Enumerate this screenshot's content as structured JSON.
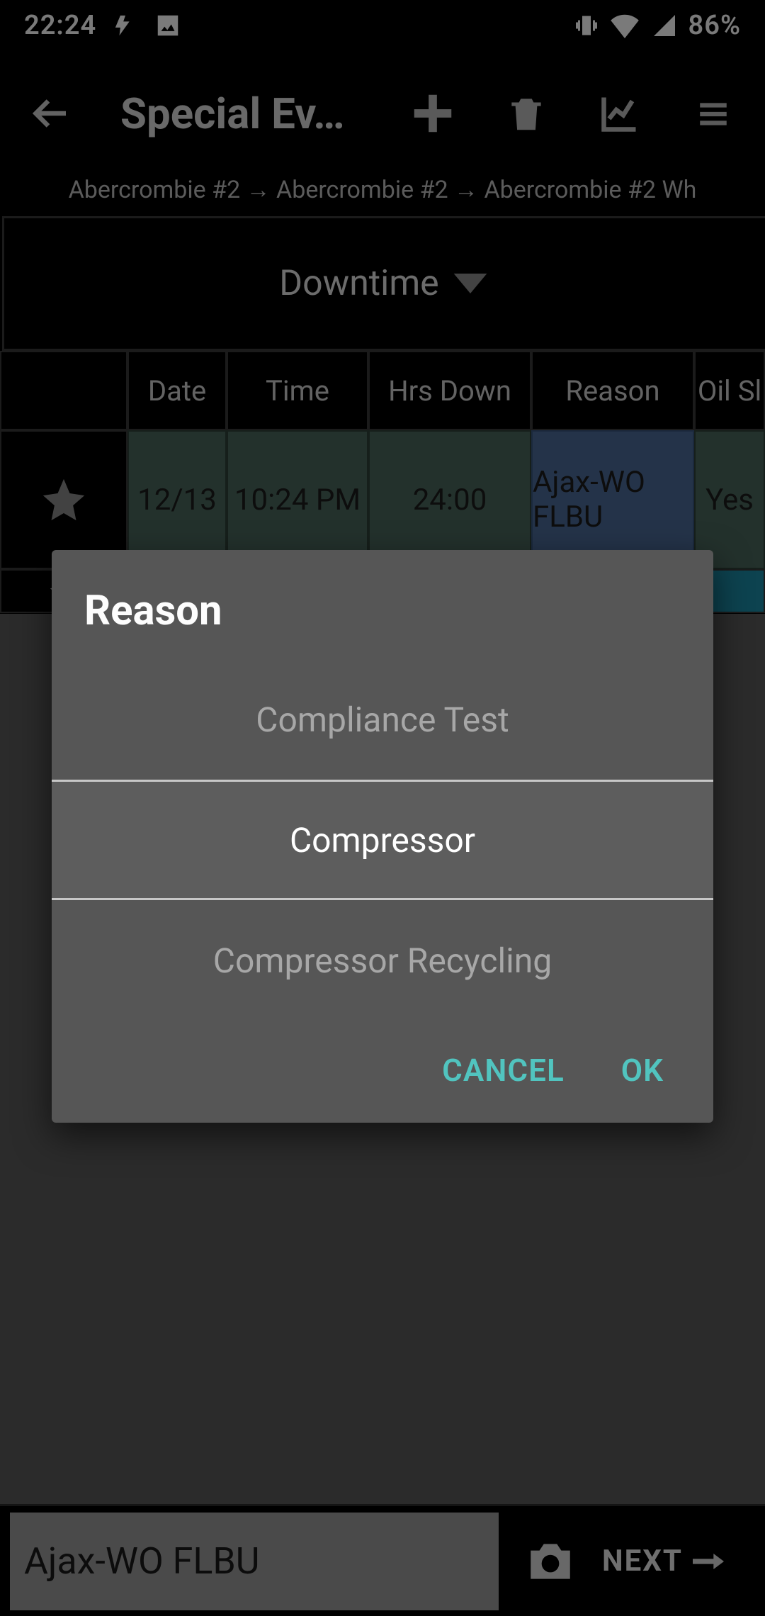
{
  "status": {
    "time": "22:24",
    "battery": "86%"
  },
  "appbar": {
    "title": "Special Ev…"
  },
  "breadcrumb": {
    "path": "Abercrombie #2 → Abercrombie #2 → Abercrombie #2 Wh"
  },
  "category": {
    "label": "Downtime"
  },
  "table": {
    "columns": [
      "",
      "Date",
      "Time",
      "Hrs Down",
      "Reason",
      "Oil Sl"
    ],
    "row": {
      "date": "12/13",
      "time": "10:24 PM",
      "hrs_down": "24:00",
      "reason": "Ajax-WO FLBU",
      "oil": "Yes"
    }
  },
  "dialog": {
    "title": "Reason",
    "options": [
      "Compliance Test",
      "Compressor",
      "Compressor Recycling"
    ],
    "selected_index": 1,
    "cancel": "CANCEL",
    "ok": "OK"
  },
  "bottom": {
    "field_value": "Ajax-WO FLBU",
    "next": "NEXT"
  }
}
